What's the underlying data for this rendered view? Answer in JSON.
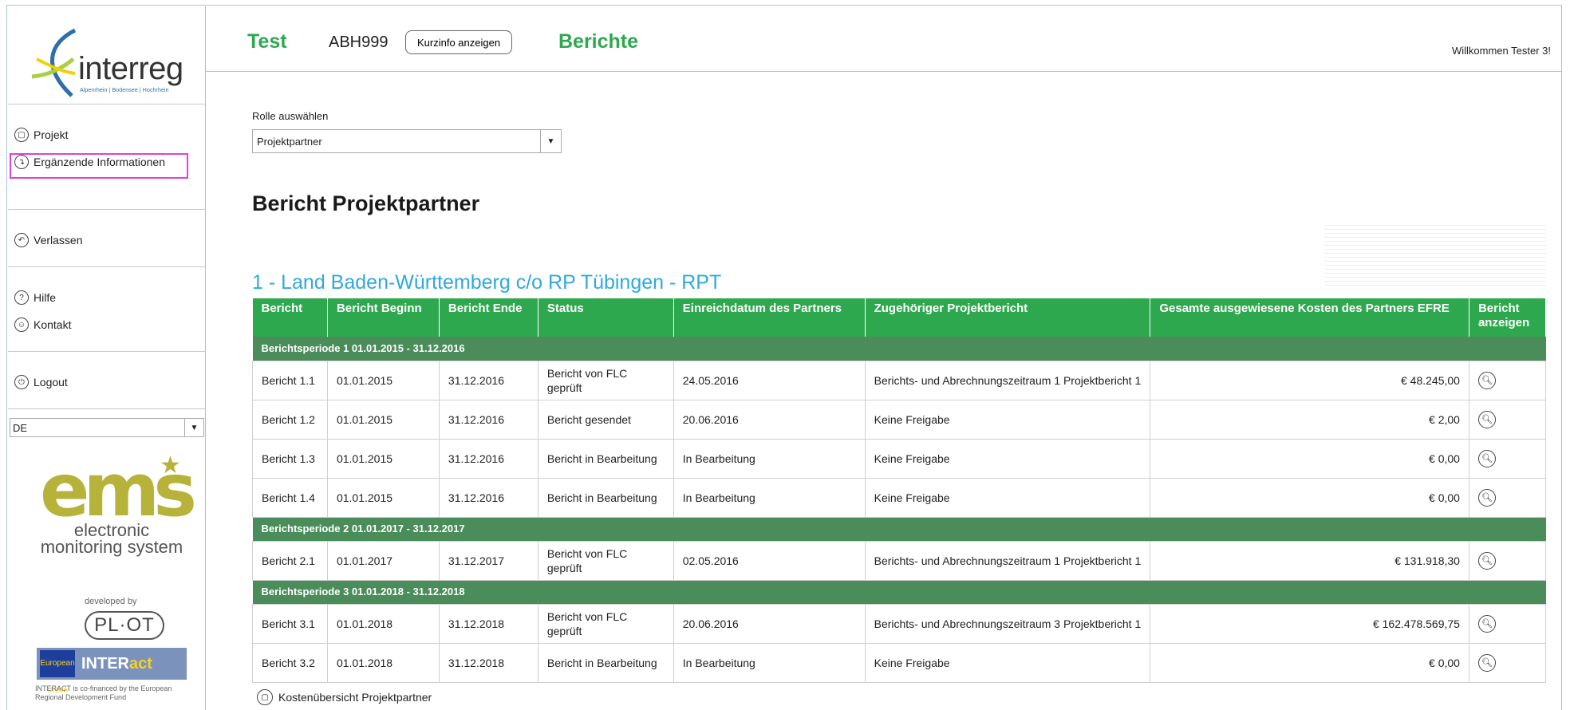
{
  "brand": {
    "logo_word": "interreg",
    "logo_tagline": "Alpenrhein | Bodensee | Hochrhein",
    "ems_big": "ems",
    "ems_sub": "electronic monitoring system",
    "developed_by": "developed by",
    "plot": "PL·OT",
    "interact_a": "INTER",
    "interact_b": "act",
    "eu_label": "European Union",
    "cofinanced": "INTERACT is co-financed by the European Regional Development Fund"
  },
  "sidebar": {
    "items": [
      {
        "label": "Projekt",
        "icon": "document-icon"
      },
      {
        "label": "Ergänzende Informationen",
        "icon": "info-icon"
      },
      {
        "label": "Verlassen",
        "icon": "back-arrow-icon"
      },
      {
        "label": "Hilfe",
        "icon": "help-icon"
      },
      {
        "label": "Kontakt",
        "icon": "contact-icon"
      },
      {
        "label": "Logout",
        "icon": "power-icon"
      }
    ],
    "language": "DE"
  },
  "header": {
    "test": "Test",
    "code": "ABH999",
    "kurzinfo_button": "Kurzinfo anzeigen",
    "section": "Berichte",
    "welcome": "Willkommen Tester 3!"
  },
  "main": {
    "role_label": "Rolle auswählen",
    "role_value": "Projektpartner",
    "title": "Bericht Projektpartner",
    "partner_title": "1 - Land Baden-Württemberg c/o RP Tübingen - RPT",
    "columns": [
      "Bericht",
      "Bericht Beginn",
      "Bericht Ende",
      "Status",
      "Einreichdatum des Partners",
      "Zugehöriger Projektbericht",
      "Gesamte ausgewiesene Kosten des Partners EFRE",
      "Bericht anzeigen"
    ],
    "periods": [
      {
        "label": "Berichtsperiode 1 01.01.2015 - 31.12.2016",
        "rows": [
          {
            "bericht": "Bericht 1.1",
            "beginn": "01.01.2015",
            "ende": "31.12.2016",
            "status": "Bericht von FLC geprüft",
            "einreich": "24.05.2016",
            "projekt": "Berichts- und Abrechnungszeitraum 1 Projektbericht 1",
            "kosten": "€ 48.245,00"
          },
          {
            "bericht": "Bericht 1.2",
            "beginn": "01.01.2015",
            "ende": "31.12.2016",
            "status": "Bericht gesendet",
            "einreich": "20.06.2016",
            "projekt": "Keine Freigabe",
            "kosten": "€ 2,00"
          },
          {
            "bericht": "Bericht 1.3",
            "beginn": "01.01.2015",
            "ende": "31.12.2016",
            "status": "Bericht in Bearbeitung",
            "einreich": "In Bearbeitung",
            "projekt": "Keine Freigabe",
            "kosten": "€ 0,00"
          },
          {
            "bericht": "Bericht 1.4",
            "beginn": "01.01.2015",
            "ende": "31.12.2016",
            "status": "Bericht in Bearbeitung",
            "einreich": "In Bearbeitung",
            "projekt": "Keine Freigabe",
            "kosten": "€ 0,00"
          }
        ]
      },
      {
        "label": "Berichtsperiode 2 01.01.2017 - 31.12.2017",
        "rows": [
          {
            "bericht": "Bericht 2.1",
            "beginn": "01.01.2017",
            "ende": "31.12.2017",
            "status": "Bericht von FLC geprüft",
            "einreich": "02.05.2016",
            "projekt": "Berichts- und Abrechnungszeitraum 1 Projektbericht 1",
            "kosten": "€ 131.918,30"
          }
        ]
      },
      {
        "label": "Berichtsperiode 3 01.01.2018 - 31.12.2018",
        "rows": [
          {
            "bericht": "Bericht 3.1",
            "beginn": "01.01.2018",
            "ende": "31.12.2018",
            "status": "Bericht von FLC geprüft",
            "einreich": "20.06.2016",
            "projekt": "Berichts- und Abrechnungszeitraum 3 Projektbericht 1",
            "kosten": "€ 162.478.569,75"
          },
          {
            "bericht": "Bericht 3.2",
            "beginn": "01.01.2018",
            "ende": "31.12.2018",
            "status": "Bericht in Bearbeitung",
            "einreich": "In Bearbeitung",
            "projekt": "Keine Freigabe",
            "kosten": "€ 0,00"
          }
        ]
      }
    ],
    "cost_link": "Kostenübersicht Projektpartner"
  }
}
